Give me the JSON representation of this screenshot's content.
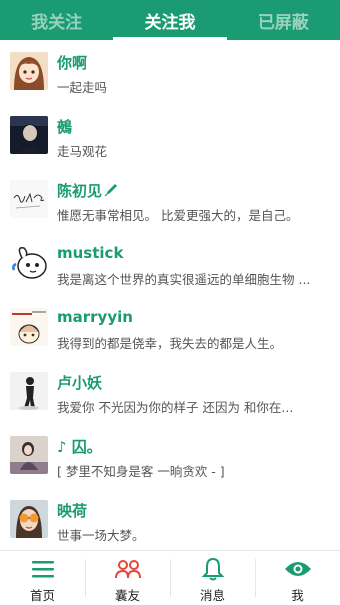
{
  "colors": {
    "accent": "#1a9b72",
    "unfollow_icon": "#e8453c"
  },
  "top_tabs": [
    {
      "label": "我关注",
      "active": false
    },
    {
      "label": "关注我",
      "active": true
    },
    {
      "label": "已屏蔽",
      "active": false
    }
  ],
  "users": [
    {
      "name": "你啊",
      "signature": "一起走吗",
      "avatar": "cartoon-girl-avatar"
    },
    {
      "name": "鵺",
      "signature": "走马观花",
      "avatar": "dark-portrait-avatar"
    },
    {
      "name": "陈初见",
      "signature": "惟愿无事常相见。 比爱更强大的，是自己。",
      "avatar": "handwriting-avatar",
      "name_icon": "pen-icon"
    },
    {
      "name": "mustick",
      "signature": "我是离这个世界的真实很遥远的单细胞生物 ...",
      "avatar": "rabbit-cartoon-avatar"
    },
    {
      "name": "marryyin",
      "signature": "我得到的都是侥幸，我失去的都是人生。",
      "avatar": "comic-avatar"
    },
    {
      "name": "卢小妖",
      "signature": "我爱你 不光因为你的样子 还因为 和你在...",
      "avatar": "silhouette-avatar"
    },
    {
      "name": "♪ 囚。",
      "signature": "[ 梦里不知身是客 一晌贪欢 - ]",
      "avatar": "girl-photo-avatar"
    },
    {
      "name": "映荷",
      "signature": "世事一场大梦。",
      "avatar": "sunglasses-avatar"
    }
  ],
  "bottom_nav": [
    {
      "label": "首页",
      "icon": "hamburger-menu-icon"
    },
    {
      "label": "囊友",
      "icon": "friends-icon"
    },
    {
      "label": "消息",
      "icon": "bell-icon"
    },
    {
      "label": "我",
      "icon": "eye-icon"
    }
  ]
}
